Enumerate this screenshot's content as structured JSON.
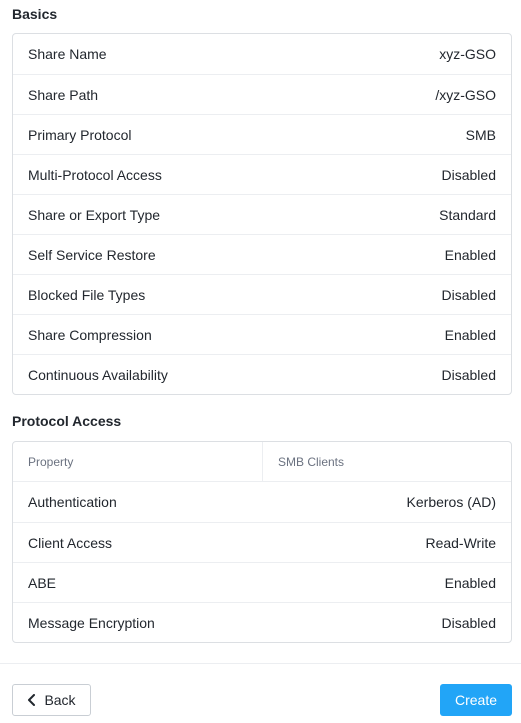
{
  "basics": {
    "title": "Basics",
    "rows": [
      {
        "label": "Share Name",
        "value": "xyz-GSO"
      },
      {
        "label": "Share Path",
        "value": "/xyz-GSO"
      },
      {
        "label": "Primary Protocol",
        "value": "SMB"
      },
      {
        "label": "Multi-Protocol Access",
        "value": "Disabled"
      },
      {
        "label": "Share or Export Type",
        "value": "Standard"
      },
      {
        "label": "Self Service Restore",
        "value": "Enabled"
      },
      {
        "label": "Blocked File Types",
        "value": "Disabled"
      },
      {
        "label": "Share Compression",
        "value": "Enabled"
      },
      {
        "label": "Continuous Availability",
        "value": "Disabled"
      }
    ]
  },
  "protocol_access": {
    "title": "Protocol Access",
    "columns": [
      "Property",
      "SMB Clients"
    ],
    "rows": [
      {
        "label": "Authentication",
        "value": "Kerberos (AD)"
      },
      {
        "label": "Client Access",
        "value": "Read-Write"
      },
      {
        "label": "ABE",
        "value": "Enabled"
      },
      {
        "label": "Message Encryption",
        "value": "Disabled"
      }
    ]
  },
  "footer": {
    "back_label": "Back",
    "back_icon": "chevron-left-icon",
    "create_label": "Create",
    "accent_color": "#22a5f7"
  }
}
